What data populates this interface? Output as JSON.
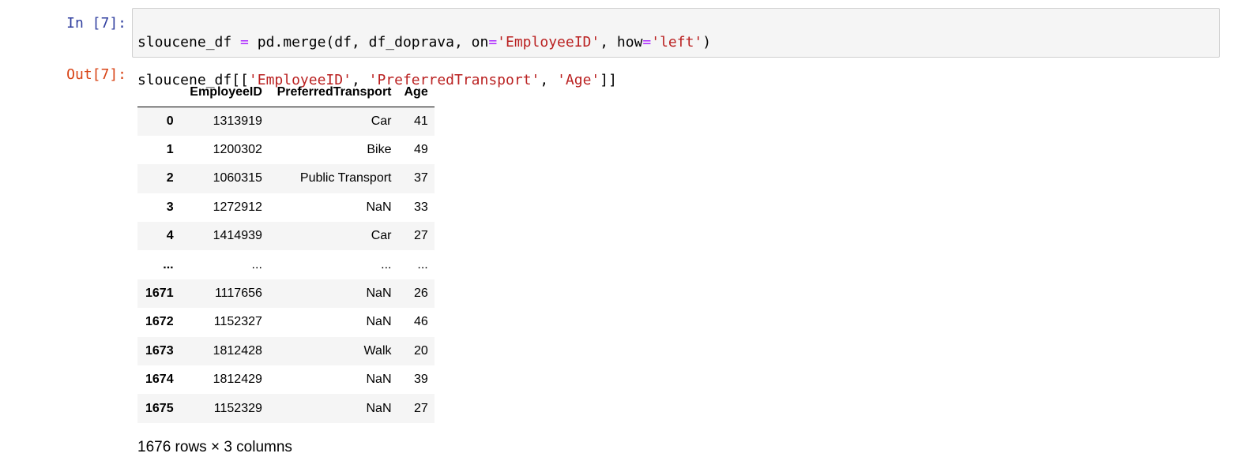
{
  "input_prompt": "In [7]:",
  "output_prompt": "Out[7]:",
  "code": {
    "line1": {
      "a": "sloucene_df ",
      "op1": "=",
      "b": " pd.merge(df, df_doprava, on",
      "op2": "=",
      "s1": "'EmployeeID'",
      "c": ", how",
      "op3": "=",
      "s2": "'left'",
      "d": ")"
    },
    "line2": {
      "a": "sloucene_df[[",
      "s1": "'EmployeeID'",
      "b": ", ",
      "s2": "'PreferredTransport'",
      "c": ", ",
      "s3": "'Age'",
      "d": "]]"
    }
  },
  "table": {
    "columns": [
      "",
      "EmployeeID",
      "PreferredTransport",
      "Age"
    ],
    "rows": [
      [
        "0",
        "1313919",
        "Car",
        "41"
      ],
      [
        "1",
        "1200302",
        "Bike",
        "49"
      ],
      [
        "2",
        "1060315",
        "Public Transport",
        "37"
      ],
      [
        "3",
        "1272912",
        "NaN",
        "33"
      ],
      [
        "4",
        "1414939",
        "Car",
        "27"
      ],
      [
        "...",
        "...",
        "...",
        "..."
      ],
      [
        "1671",
        "1117656",
        "NaN",
        "26"
      ],
      [
        "1672",
        "1152327",
        "NaN",
        "46"
      ],
      [
        "1673",
        "1812428",
        "Walk",
        "20"
      ],
      [
        "1674",
        "1812429",
        "NaN",
        "39"
      ],
      [
        "1675",
        "1152329",
        "NaN",
        "27"
      ]
    ]
  },
  "shape_text": "1676 rows × 3 columns"
}
